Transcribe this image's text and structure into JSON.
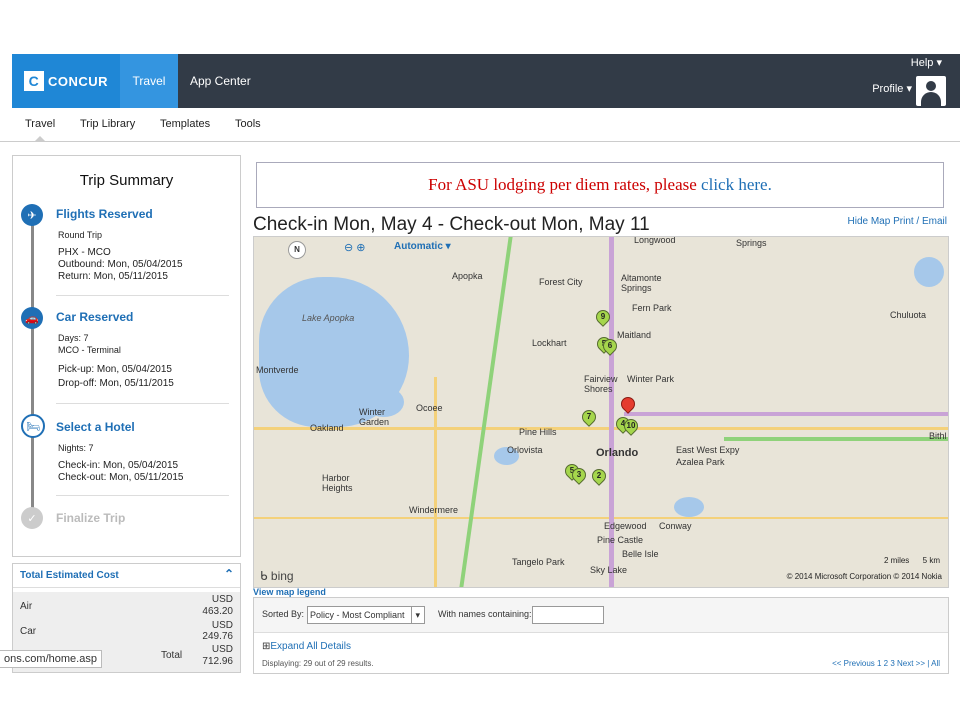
{
  "header": {
    "logo_text": "CONCUR",
    "logo_mark": "C",
    "nav_travel": "Travel",
    "nav_app_center": "App Center",
    "help": "Help",
    "profile": "Profile"
  },
  "subnav": [
    "Travel",
    "Trip Library",
    "Templates",
    "Tools"
  ],
  "trip": {
    "title": "Trip Summary",
    "flight": {
      "title": "Flights Reserved",
      "type": "Round Trip",
      "route": "PHX - MCO",
      "outbound": "Outbound: Mon, 05/04/2015",
      "return": "Return: Mon, 05/11/2015"
    },
    "car": {
      "title": "Car Reserved",
      "days": "Days: 7",
      "location": "MCO - Terminal",
      "pickup": "Pick-up: Mon, 05/04/2015",
      "dropoff": "Drop-off: Mon, 05/11/2015"
    },
    "hotel": {
      "title": "Select a Hotel",
      "nights": "Nights: 7",
      "checkin": "Check-in: Mon, 05/04/2015",
      "checkout": "Check-out: Mon, 05/11/2015"
    },
    "finalize": "Finalize Trip"
  },
  "cost": {
    "title": "Total Estimated Cost",
    "rows": [
      {
        "label": "Air",
        "currency": "USD",
        "amount": "463.20"
      },
      {
        "label": "Car",
        "currency": "USD",
        "amount": "249.76"
      },
      {
        "label": "Total",
        "currency": "USD",
        "amount": "712.96"
      }
    ]
  },
  "url_fragment": "ons.com/home.asp",
  "banner": {
    "text": "For ASU lodging per diem rates, please ",
    "link": "click here."
  },
  "checkin_heading": "Check-in Mon, May 4 - Check-out Mon, May 11",
  "map_links": {
    "hide": "Hide Map",
    "print": "Print / Email"
  },
  "map": {
    "mode": "Automatic",
    "compass": "N",
    "copyright": "© 2014 Microsoft Corporation   © 2014 Nokia",
    "scale_miles": "2 miles",
    "scale_km": "5 km",
    "provider": "bing",
    "places": [
      "Longwood",
      "Springs",
      "Apopka",
      "Forest City",
      "Altamonte Springs",
      "Fern Park",
      "Chuluota",
      "Lake Apopka",
      "Maitland",
      "Lockhart",
      "Winter Park",
      "Fairview Shores",
      "Montverde",
      "Winter Garden",
      "Ocoee",
      "Oakland",
      "Pine Hills",
      "Orlovista",
      "East West Expy",
      "Azalea Park",
      "Orlando",
      "Harbor Heights",
      "Windermere",
      "Edgewood",
      "Conway",
      "Pine Castle",
      "Belle Isle",
      "Tangelo Park",
      "Sky Lake",
      "Bithl"
    ],
    "pins": [
      "9",
      "5",
      "6",
      "7",
      "4",
      "10",
      "5",
      "3",
      "2"
    ]
  },
  "legend_link": "View map legend",
  "results": {
    "sorted_by_label": "Sorted By:",
    "sorted_by_value": "Policy - Most Compliant",
    "names_label": "With names containing:",
    "expand": "Expand All Details",
    "displaying": "Displaying: 29 out of 29 results.",
    "pager": "<< Previous 1 2 3  Next >>  |  All"
  }
}
